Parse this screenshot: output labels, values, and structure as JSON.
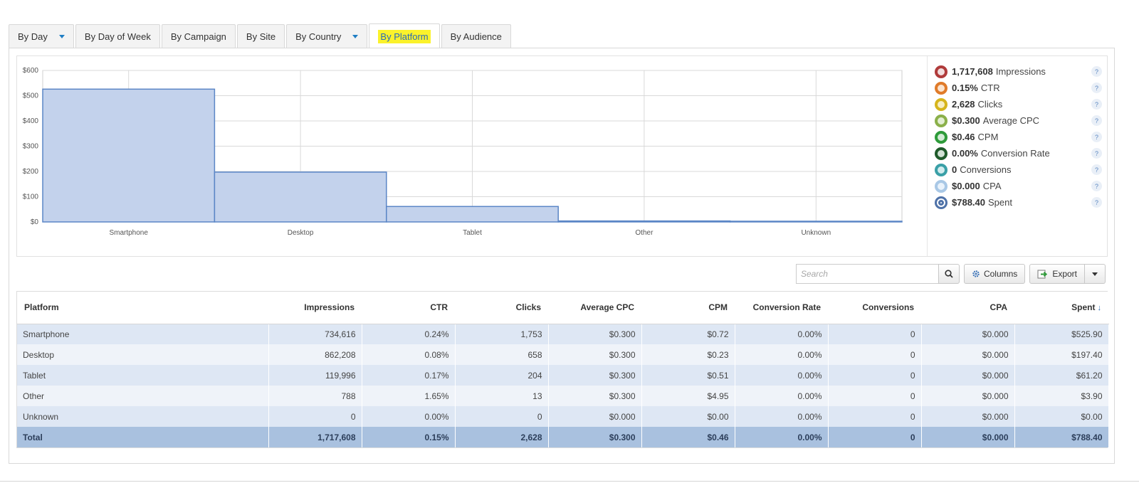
{
  "tabs": [
    {
      "label": "By Day",
      "has_dropdown": true,
      "active": false
    },
    {
      "label": "By Day of Week",
      "has_dropdown": false,
      "active": false
    },
    {
      "label": "By Campaign",
      "has_dropdown": false,
      "active": false
    },
    {
      "label": "By Site",
      "has_dropdown": false,
      "active": false
    },
    {
      "label": "By Country",
      "has_dropdown": true,
      "active": false
    },
    {
      "label": "By Platform",
      "has_dropdown": false,
      "active": true
    },
    {
      "label": "By Audience",
      "has_dropdown": false,
      "active": false
    }
  ],
  "chart_data": {
    "type": "bar",
    "categories": [
      "Smartphone",
      "Desktop",
      "Tablet",
      "Other",
      "Unknown"
    ],
    "values": [
      525.9,
      197.4,
      61.2,
      3.9,
      0
    ],
    "y_ticks": [
      "$0",
      "$100",
      "$200",
      "$300",
      "$400",
      "$500",
      "$600"
    ],
    "ylim": [
      0,
      600
    ],
    "grid": true,
    "bar_color": "#c3d2ec",
    "bar_stroke": "#5b86c6"
  },
  "legend": [
    {
      "value": "1,717,608",
      "label": "Impressions",
      "color": "#b03b3b",
      "fill": "#f2dede"
    },
    {
      "value": "0.15%",
      "label": "CTR",
      "color": "#e07b2a",
      "fill": "#fbe4cf"
    },
    {
      "value": "2,628",
      "label": "Clicks",
      "color": "#d6b51d",
      "fill": "#f8efc4"
    },
    {
      "value": "$0.300",
      "label": "Average CPC",
      "color": "#8bb04a",
      "fill": "#e3eed3"
    },
    {
      "value": "$0.46",
      "label": "CPM",
      "color": "#2e9b3a",
      "fill": "#d3ecd6"
    },
    {
      "value": "0.00%",
      "label": "Conversion Rate",
      "color": "#1f5a2a",
      "fill": "#d2e2d5"
    },
    {
      "value": "0",
      "label": "Conversions",
      "color": "#3aa0a7",
      "fill": "#d3ecee"
    },
    {
      "value": "$0.000",
      "label": "CPA",
      "color": "#a9c8e6",
      "fill": "#e9f2fb"
    },
    {
      "value": "$788.40",
      "label": "Spent",
      "color": "#4f72a8",
      "fill": "#ffffff"
    }
  ],
  "legend_help": "?",
  "toolbar": {
    "search_placeholder": "Search",
    "columns_label": "Columns",
    "export_label": "Export"
  },
  "table": {
    "columns": [
      "Platform",
      "Impressions",
      "CTR",
      "Clicks",
      "Average CPC",
      "CPM",
      "Conversion Rate",
      "Conversions",
      "CPA",
      "Spent"
    ],
    "sort_indicator": "↓",
    "rows": [
      [
        "Smartphone",
        "734,616",
        "0.24%",
        "1,753",
        "$0.300",
        "$0.72",
        "0.00%",
        "0",
        "$0.000",
        "$525.90"
      ],
      [
        "Desktop",
        "862,208",
        "0.08%",
        "658",
        "$0.300",
        "$0.23",
        "0.00%",
        "0",
        "$0.000",
        "$197.40"
      ],
      [
        "Tablet",
        "119,996",
        "0.17%",
        "204",
        "$0.300",
        "$0.51",
        "0.00%",
        "0",
        "$0.000",
        "$61.20"
      ],
      [
        "Other",
        "788",
        "1.65%",
        "13",
        "$0.300",
        "$4.95",
        "0.00%",
        "0",
        "$0.000",
        "$3.90"
      ],
      [
        "Unknown",
        "0",
        "0.00%",
        "0",
        "$0.000",
        "$0.00",
        "0.00%",
        "0",
        "$0.000",
        "$0.00"
      ]
    ],
    "total": [
      "Total",
      "1,717,608",
      "0.15%",
      "2,628",
      "$0.300",
      "$0.46",
      "0.00%",
      "0",
      "$0.000",
      "$788.40"
    ]
  }
}
